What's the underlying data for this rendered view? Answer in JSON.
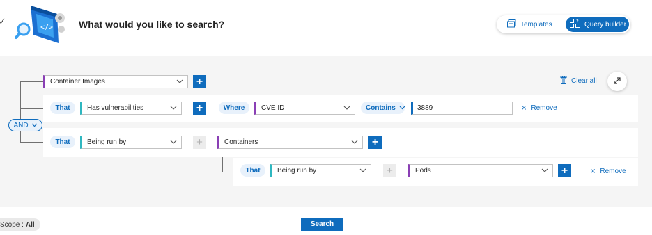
{
  "header": {
    "title": "What would you like to search?",
    "back_glyph": "✓",
    "illustration_icon": "search-illustration-icon",
    "templates_label": "Templates",
    "query_builder_label": "Query builder"
  },
  "toolbar": {
    "clear_all_label": "Clear all",
    "expand_icon": "expand-icon"
  },
  "query": {
    "root_entity": "Container Images",
    "operator": "AND",
    "conditions": [
      {
        "connector": "That",
        "relation": "Has vulnerabilities",
        "filter_connector": "Where",
        "filter_field": "CVE ID",
        "filter_operator": "Contains",
        "filter_value": "3889",
        "remove_label": "Remove"
      },
      {
        "connector": "That",
        "relation": "Being run by",
        "target_entity": "Containers",
        "nested": {
          "connector": "That",
          "relation": "Being run by",
          "target_entity": "Pods",
          "remove_label": "Remove"
        }
      }
    ]
  },
  "footer": {
    "scope_label": "Scope :",
    "scope_value": "All",
    "search_label": "Search"
  },
  "colors": {
    "accent": "#0f6cbd",
    "entity_marker": "#8a3fb5",
    "relation_marker": "#2fb7c0",
    "canvas_bg": "#f5f5f5"
  }
}
